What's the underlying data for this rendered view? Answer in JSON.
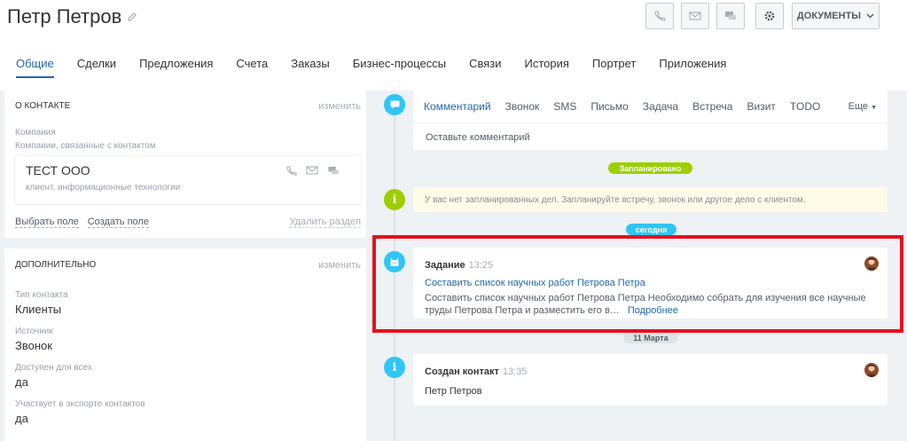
{
  "header": {
    "title": "Петр Петров",
    "documents_label": "ДОКУМЕНТЫ"
  },
  "tabs": [
    {
      "label": "Общие",
      "active": true
    },
    {
      "label": "Сделки"
    },
    {
      "label": "Предложения"
    },
    {
      "label": "Счета"
    },
    {
      "label": "Заказы"
    },
    {
      "label": "Бизнес-процессы"
    },
    {
      "label": "Связи"
    },
    {
      "label": "История"
    },
    {
      "label": "Портрет"
    },
    {
      "label": "Приложения"
    }
  ],
  "contact_card": {
    "heading": "О КОНТАКТЕ",
    "edit": "изменить",
    "company_label": "Компания",
    "company_hint": "Компании, связанные с контактом",
    "company_name": "ТЕСТ ООО",
    "company_desc": "клиент, информационные технологии",
    "select_field": "Выбрать поле",
    "create_field": "Создать поле",
    "delete_section": "Удалить раздел"
  },
  "extra_card": {
    "heading": "ДОПОЛНИТЕЛЬНО",
    "edit": "изменить",
    "fields": [
      {
        "label": "Тип контакта",
        "value": "Клиенты"
      },
      {
        "label": "Источник",
        "value": "Звонок"
      },
      {
        "label": "Доступен для всех",
        "value": "да"
      },
      {
        "label": "Участвует в экспорте контактов",
        "value": "да"
      }
    ]
  },
  "composer": {
    "tabs": [
      "Комментарий",
      "Звонок",
      "SMS",
      "Письмо",
      "Задача",
      "Встреча",
      "Визит",
      "TODO"
    ],
    "more": "Еще",
    "placeholder": "Оставьте комментарий"
  },
  "timeline": {
    "planned_label": "Запланировано",
    "planned_info": "У вас нет запланированных дел. Запланируйте встречу, звонок или другое дело с клиентом.",
    "today_label": "сегодня",
    "task": {
      "type": "Задание",
      "time": "13:25",
      "title": "Составить список научных работ Петрова Петра",
      "body": "Составить список научных работ Петрова Петра Необходимо собрать для изучения все научные труды Петрова Петра и разместить его в…",
      "more": "Подробнее"
    },
    "date_label": "11 Марта",
    "created": {
      "type": "Создан контакт",
      "time": "13:35",
      "name": "Петр Петров"
    }
  },
  "colors": {
    "accent": "#2067b0",
    "green": "#9dcf00",
    "blue_icon": "#2fc6f6",
    "highlight": "#e7101e"
  }
}
